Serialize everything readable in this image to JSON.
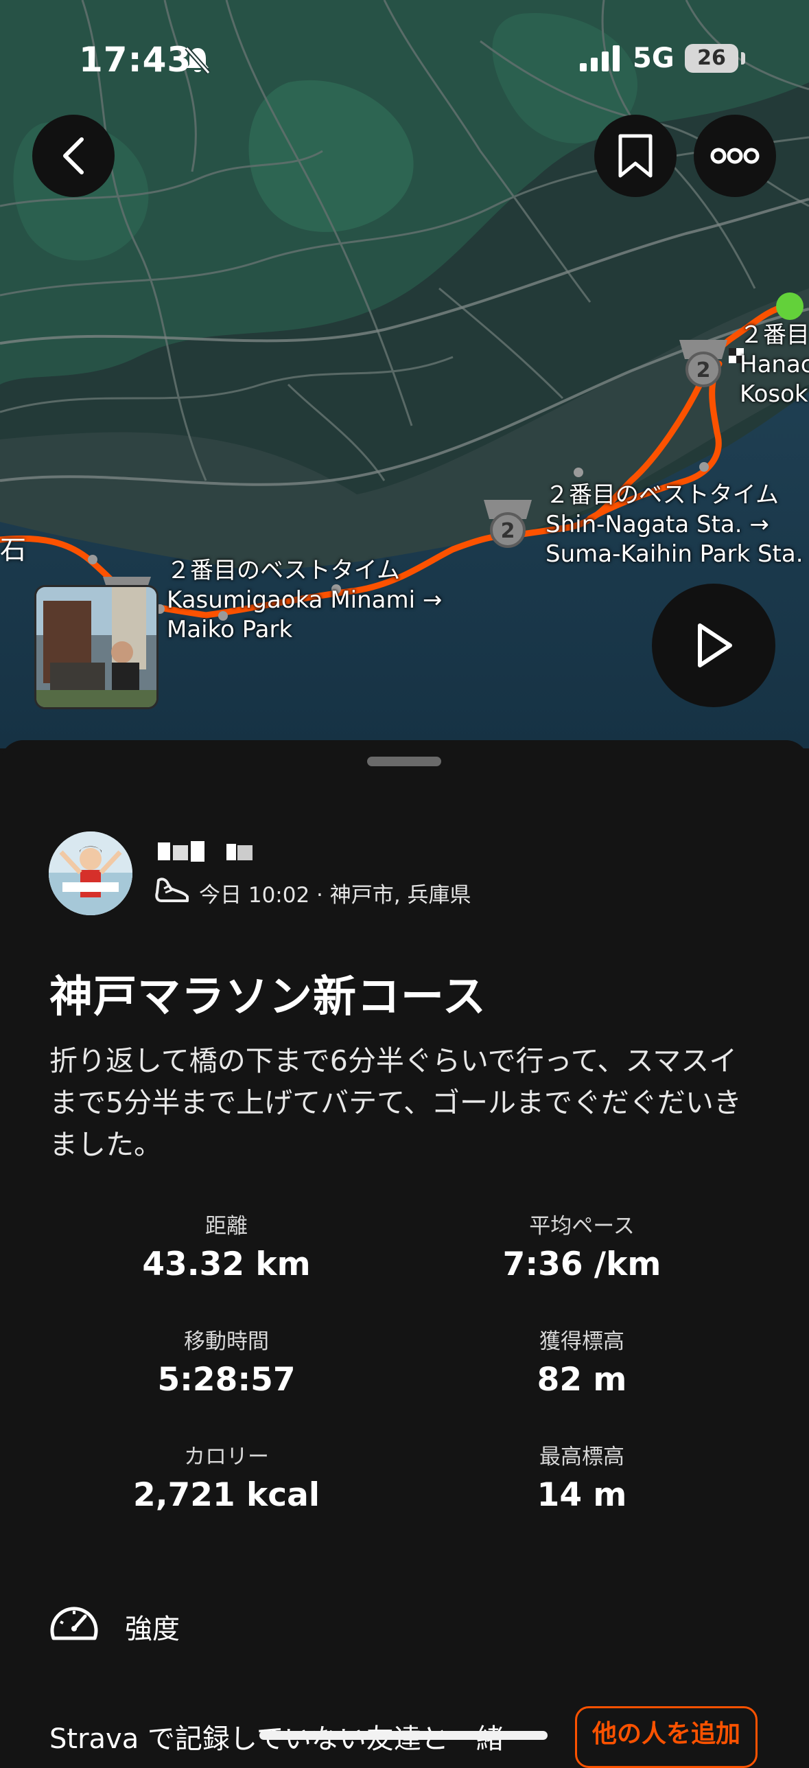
{
  "status_bar": {
    "time": "17:43",
    "network": "5G",
    "battery": "26"
  },
  "map": {
    "segments": [
      {
        "badge": "2",
        "lines": [
          "２番目のベストタイム",
          "Kasumigaoka Minami →",
          "Maiko Park"
        ]
      },
      {
        "badge": "2",
        "lines": [
          "２番目のベストタイム",
          "Shin-Nagata Sta. →",
          "Suma-Kaihin Park Sta."
        ]
      },
      {
        "badge": "2",
        "lines": [
          "２番目",
          "Hanac",
          "Kosok"
        ]
      }
    ],
    "place_label": "石"
  },
  "icons": {
    "back": "chevron-left-icon",
    "save": "bookmark-icon",
    "more": "more-horizontal-icon",
    "play": "play-icon",
    "sport": "running-shoe-icon",
    "intensity": "gauge-icon",
    "silent": "bell-slash-icon",
    "signal": "cellular-signal-icon"
  },
  "colors": {
    "route": "#fc5200",
    "start": "#63d13a",
    "accent": "#fc5200",
    "background": "#141414"
  },
  "activity": {
    "meta": "今日 10:02 · 神戸市, 兵庫県",
    "title": "神戸マラソン新コース",
    "description": "折り返して橋の下まで6分半ぐらいで行って、スマスイまで5分半まで上げてバテて、ゴールまでぐだぐだいきました。",
    "stats": [
      {
        "label": "距離",
        "value": "43.32 km"
      },
      {
        "label": "平均ペース",
        "value": "7:36 /km"
      },
      {
        "label": "移動時間",
        "value": "5:28:57"
      },
      {
        "label": "獲得標高",
        "value": "82 m"
      },
      {
        "label": "カロリー",
        "value": "2,721 kcal"
      },
      {
        "label": "最高標高",
        "value": "14 m"
      }
    ],
    "intensity_label": "強度",
    "invite_text": "Strava で記録していない友達と一緒",
    "invite_button": "他の人を追加"
  }
}
